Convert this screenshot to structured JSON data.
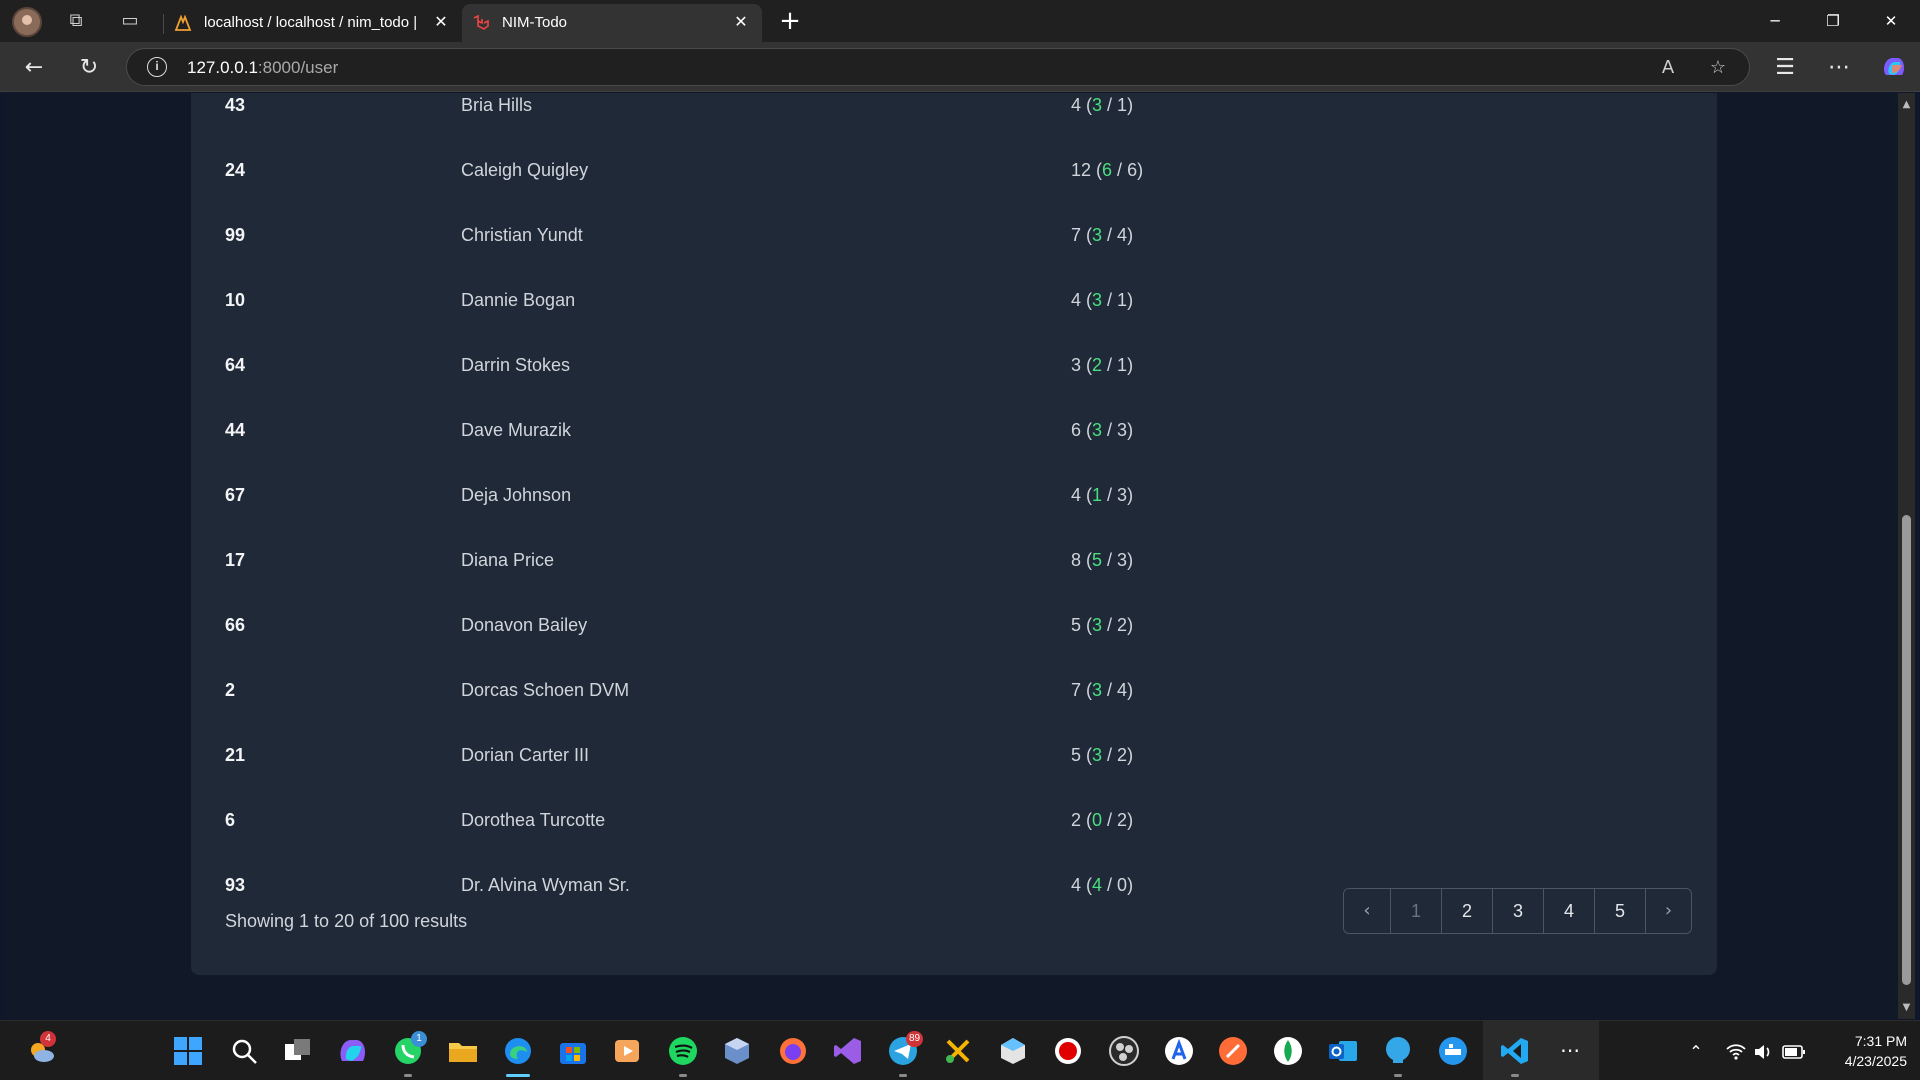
{
  "browser": {
    "tabs": [
      {
        "title": "localhost / localhost / nim_todo |"
      },
      {
        "title": "NIM-Todo"
      }
    ],
    "url_host": "127.0.0.1",
    "url_rest": ":8000/user"
  },
  "table": {
    "rows": [
      {
        "id": "43",
        "name": "Bria Hills",
        "total": "4",
        "done": "3",
        "pending": "1"
      },
      {
        "id": "24",
        "name": "Caleigh Quigley",
        "total": "12",
        "done": "6",
        "pending": "6"
      },
      {
        "id": "99",
        "name": "Christian Yundt",
        "total": "7",
        "done": "3",
        "pending": "4"
      },
      {
        "id": "10",
        "name": "Dannie Bogan",
        "total": "4",
        "done": "3",
        "pending": "1"
      },
      {
        "id": "64",
        "name": "Darrin Stokes",
        "total": "3",
        "done": "2",
        "pending": "1"
      },
      {
        "id": "44",
        "name": "Dave Murazik",
        "total": "6",
        "done": "3",
        "pending": "3"
      },
      {
        "id": "67",
        "name": "Deja Johnson",
        "total": "4",
        "done": "1",
        "pending": "3"
      },
      {
        "id": "17",
        "name": "Diana Price",
        "total": "8",
        "done": "5",
        "pending": "3"
      },
      {
        "id": "66",
        "name": "Donavon Bailey",
        "total": "5",
        "done": "3",
        "pending": "2"
      },
      {
        "id": "2",
        "name": "Dorcas Schoen DVM",
        "total": "7",
        "done": "3",
        "pending": "4"
      },
      {
        "id": "21",
        "name": "Dorian Carter III",
        "total": "5",
        "done": "3",
        "pending": "2"
      },
      {
        "id": "6",
        "name": "Dorothea Turcotte",
        "total": "2",
        "done": "0",
        "pending": "2"
      },
      {
        "id": "93",
        "name": "Dr. Alvina Wyman Sr.",
        "total": "4",
        "done": "4",
        "pending": "0"
      }
    ]
  },
  "pagination": {
    "summary": "Showing 1 to 20 of 100 results",
    "pages": [
      "1",
      "2",
      "3",
      "4",
      "5"
    ],
    "current": "1"
  },
  "taskbar": {
    "weather_badge": "4",
    "whatsapp_badge": "1",
    "telegram_badge": "89",
    "time": "7:31 PM",
    "date": "4/23/2025"
  },
  "colors": {
    "page_bg": "#111827",
    "card_bg": "#1f2937",
    "done_green": "#4ade80"
  }
}
